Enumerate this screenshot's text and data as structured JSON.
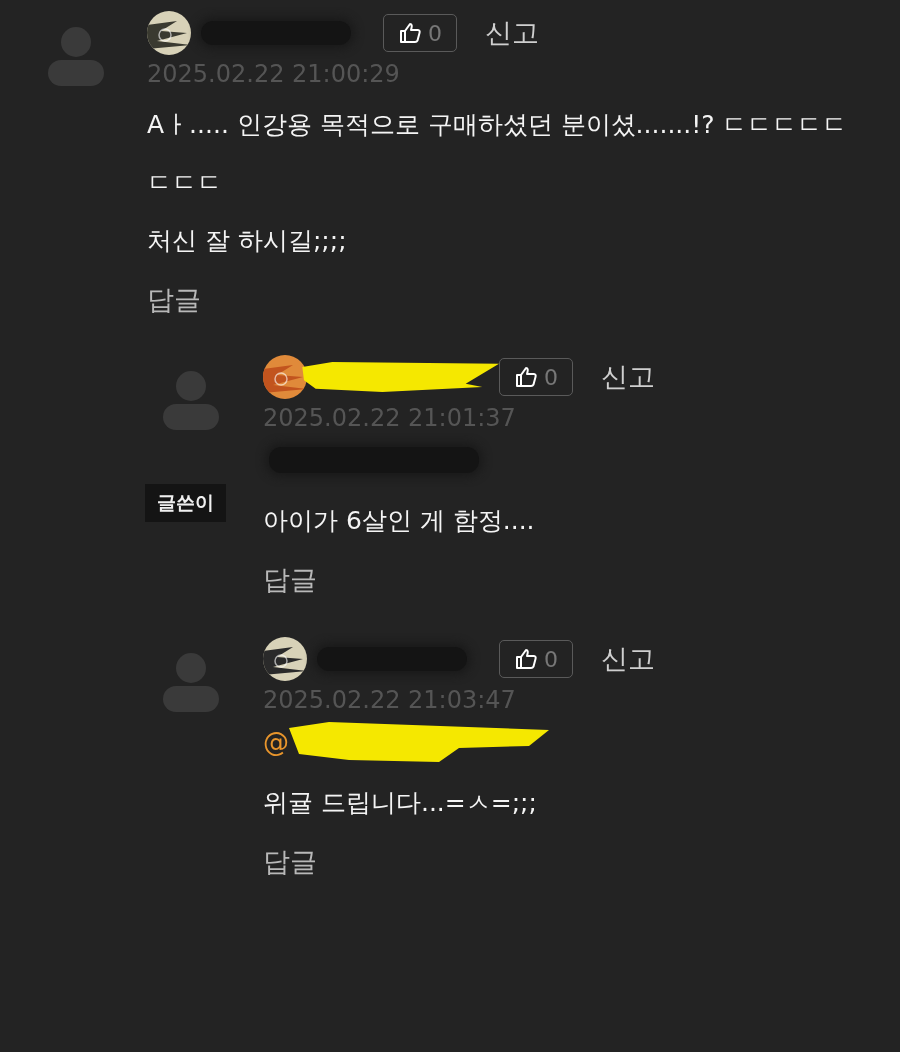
{
  "comments": [
    {
      "name_marker": false,
      "like_count": "0",
      "report": "신고",
      "date": "2025.02.22 21:00:29",
      "lines": [
        "Aㅏ..... 인강용 목적으로 구매하셨던 분이셨.......!? ㄷㄷㄷㄷㄷ",
        "ㄷㄷㄷ",
        "처신 잘 하시길;;;;"
      ],
      "reply": "답글",
      "children": [
        {
          "name_marker": true,
          "like_count": "0",
          "report": "신고",
          "date": "2025.02.22 21:01:37",
          "badge": "글쓴이",
          "mention": {
            "marker": false
          },
          "lines": [
            "아이가 6살인 게 함정...."
          ],
          "reply": "답글"
        },
        {
          "name_marker": false,
          "like_count": "0",
          "report": "신고",
          "date": "2025.02.22 21:03:47",
          "mention": {
            "text": "@",
            "marker": true
          },
          "lines": [
            "위귤 드립니다...=ㅅ=;;;"
          ],
          "reply": "답글"
        }
      ]
    }
  ]
}
